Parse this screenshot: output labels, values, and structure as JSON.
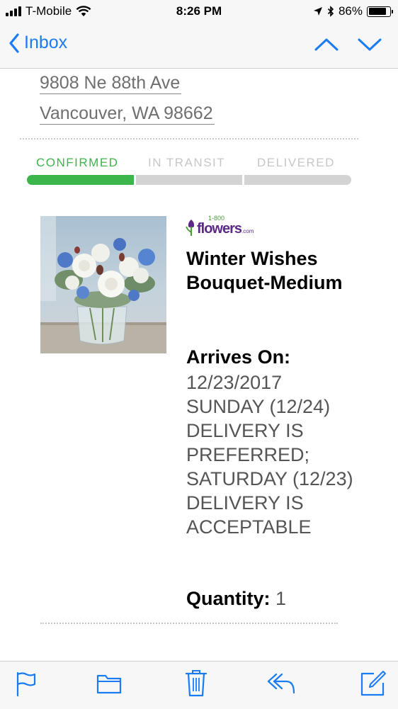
{
  "status_bar": {
    "carrier": "T-Mobile",
    "time": "8:26 PM",
    "battery_percent": "86%",
    "battery_level": 0.86
  },
  "nav": {
    "back_label": "Inbox"
  },
  "address": {
    "street": "9808 Ne 88th Ave",
    "city_line": "Vancouver, WA 98662"
  },
  "tracking": {
    "steps": [
      "CONFIRMED",
      "IN TRANSIT",
      "DELIVERED"
    ],
    "active_step": 0,
    "active_color": "#3cb54a",
    "inactive_label_color": "#c7c7c7",
    "active_label_color": "#3cb54a"
  },
  "product": {
    "brand_small": "1-800",
    "brand": "flowers",
    "brand_suffix": ".com",
    "title": "Winter Wishes Bouquet-Medium",
    "arrives_label": "Arrives On:",
    "arrives_text": "12/23/2017 SUNDAY (12/24) DELIVERY IS PREFERRED; SATURDAY (12/23) DELIVERY IS ACCEPTABLE",
    "quantity_label": "Quantity:",
    "quantity_value": "1"
  },
  "toolbar": {
    "icons": [
      "flag-icon",
      "folder-icon",
      "trash-icon",
      "reply-icon",
      "compose-icon"
    ],
    "icon_color": "#1a7cf5"
  },
  "colors": {
    "ios_blue": "#1a7cf5",
    "bar_background": "#f7f7f7",
    "brand_purple": "#5b2a86",
    "brand_green": "#4a9b3a"
  }
}
